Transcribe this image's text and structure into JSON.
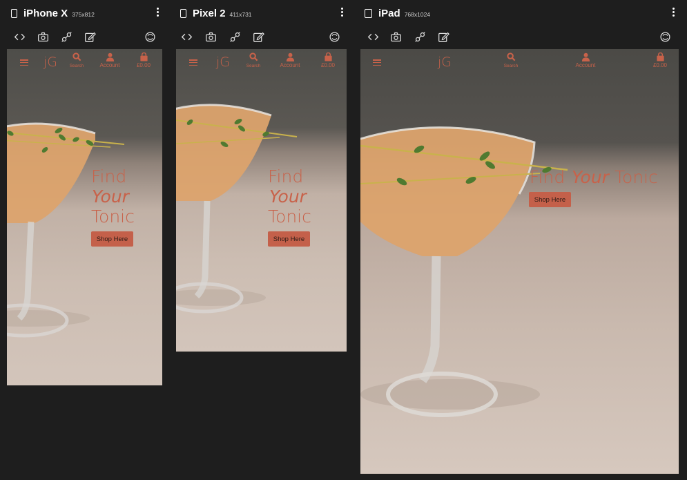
{
  "devices": [
    {
      "name": "iPhone X",
      "size": "375x812"
    },
    {
      "name": "Pixel 2",
      "size": "411x731"
    },
    {
      "name": "iPad",
      "size": "768x1024"
    }
  ],
  "toolbar_icons": [
    "code-icon",
    "screenshot-icon",
    "connect-icon",
    "edit-icon",
    "rotate-icon"
  ],
  "site": {
    "logo": "jG",
    "nav": {
      "search": "Search",
      "account": "Account",
      "cart": "£0.00"
    },
    "hero": {
      "line1": "Find",
      "line2": "Your",
      "line3": "Tonic",
      "cta": "Shop Here"
    }
  },
  "colors": {
    "accent": "#c8624a",
    "background": "#1e1e1e"
  }
}
